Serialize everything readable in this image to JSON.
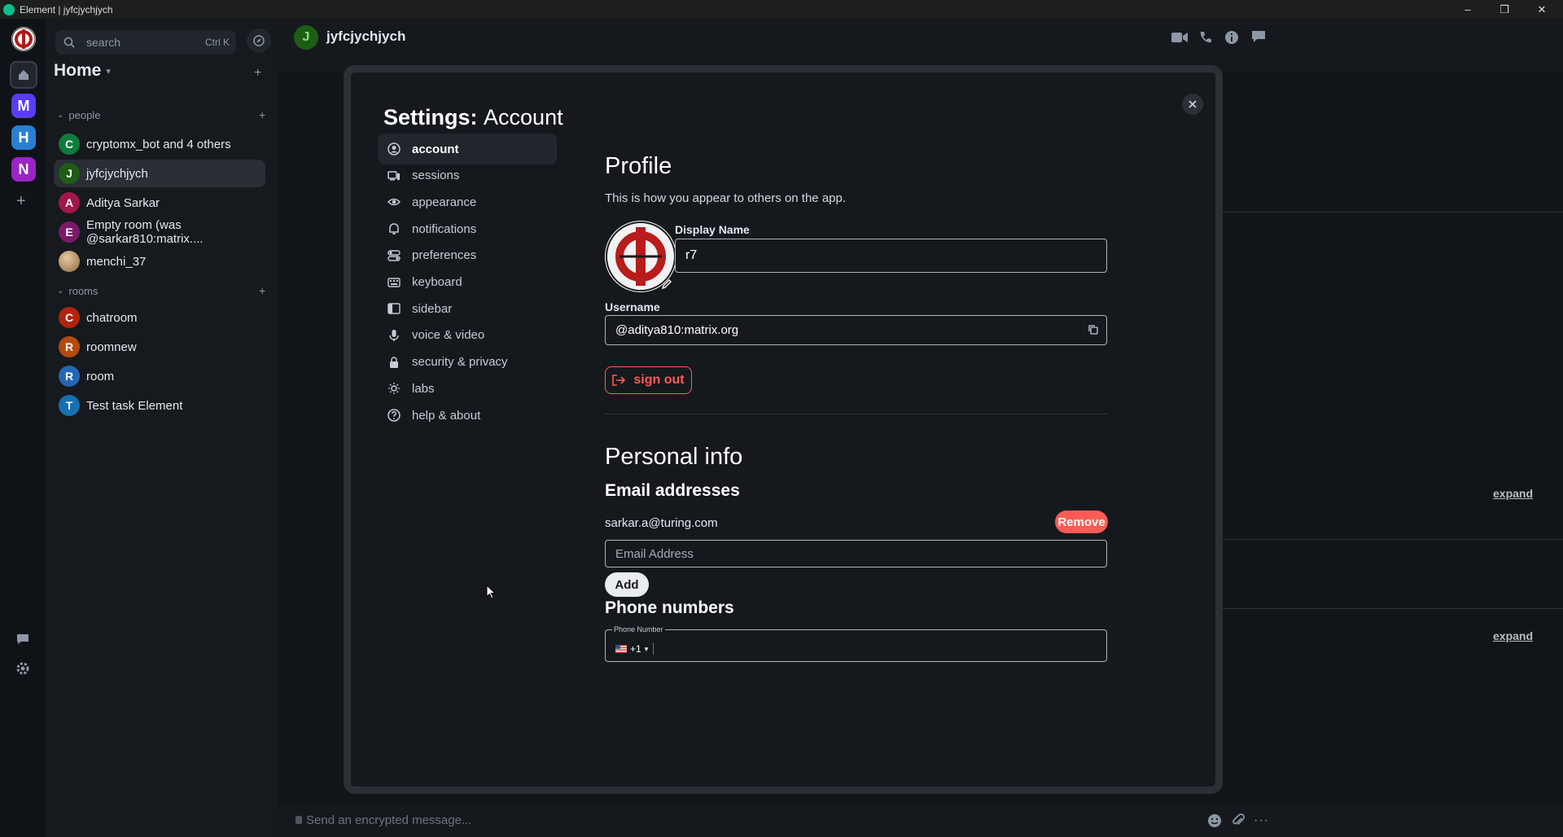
{
  "window": {
    "title": "Element | jyfcjychjych",
    "minimize": "–",
    "maximize": "❐",
    "close": "✕"
  },
  "spaces": [
    {
      "letter": "M",
      "color": "#5a3df0"
    },
    {
      "letter": "H",
      "color": "#2a7fcf"
    },
    {
      "letter": "N",
      "color": "#9c24c7"
    }
  ],
  "roomlist": {
    "search_placeholder": "search",
    "search_shortcut": "Ctrl K",
    "home_label": "Home",
    "people_label": "people",
    "rooms_label": "rooms",
    "people": [
      {
        "initial": "C",
        "name": "cryptomx_bot and 4 others",
        "color": "#0f7d3b"
      },
      {
        "initial": "J",
        "name": "jyfcjychjych",
        "color": "#1d5d14"
      },
      {
        "initial": "A",
        "name": "Aditya Sarkar",
        "color": "#a0174b"
      },
      {
        "initial": "E",
        "name": "Empty room (was @sarkar810:matrix....",
        "color": "#7a1a69"
      },
      {
        "initial": "",
        "name": "menchi_37",
        "color": "#b89060"
      }
    ],
    "rooms": [
      {
        "initial": "C",
        "name": "chatroom",
        "color": "#b0240d"
      },
      {
        "initial": "R",
        "name": "roomnew",
        "color": "#b44a10"
      },
      {
        "initial": "R",
        "name": "room",
        "color": "#2366b5"
      },
      {
        "initial": "T",
        "name": "Test task Element",
        "color": "#1670b0"
      }
    ]
  },
  "header": {
    "room_initial": "J",
    "room_name": "jyfcjychjych"
  },
  "composer": {
    "placeholder": "Send an encrypted message..."
  },
  "timeline": {
    "expand_1": "expand",
    "expand_2": "expand"
  },
  "settings": {
    "title_bold": "Settings:",
    "title_rest": "Account",
    "nav": [
      {
        "label": "account",
        "icon": "account-icon",
        "active": true
      },
      {
        "label": "sessions",
        "icon": "devices-icon",
        "active": false
      },
      {
        "label": "appearance",
        "icon": "eye-icon",
        "active": false
      },
      {
        "label": "notifications",
        "icon": "bell-icon",
        "active": false
      },
      {
        "label": "preferences",
        "icon": "toggles-icon",
        "active": false
      },
      {
        "label": "keyboard",
        "icon": "keyboard-icon",
        "active": false
      },
      {
        "label": "sidebar",
        "icon": "sidebar-icon",
        "active": false
      },
      {
        "label": "voice & video",
        "icon": "microphone-icon",
        "active": false
      },
      {
        "label": "security & privacy",
        "icon": "lock-icon",
        "active": false
      },
      {
        "label": "labs",
        "icon": "bulb-icon",
        "active": false
      },
      {
        "label": "help & about",
        "icon": "help-icon",
        "active": false
      }
    ],
    "profile": {
      "heading": "Profile",
      "subtitle": "This is how you appear to others on the app.",
      "display_name_label": "Display Name",
      "display_name_value": "r7",
      "username_label": "Username",
      "username_value": "@aditya810:matrix.org",
      "sign_out_label": "sign out"
    },
    "personal_info": {
      "heading": "Personal info",
      "email_heading": "Email addresses",
      "email_value": "sarkar.a@turing.com",
      "remove_label": "Remove",
      "email_placeholder": "Email Address",
      "add_label": "Add",
      "phone_heading": "Phone numbers",
      "phone_field_label": "Phone Number",
      "phone_country_code": "+1"
    }
  }
}
